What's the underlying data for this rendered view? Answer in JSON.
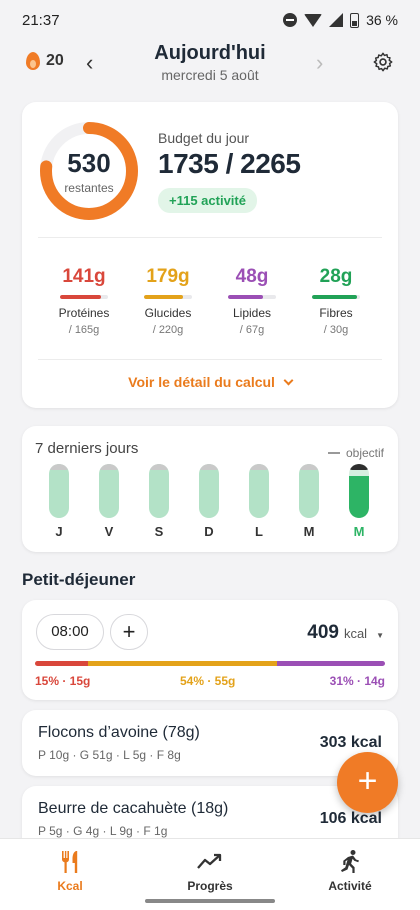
{
  "status_bar": {
    "time": "21:37",
    "battery": "36 %"
  },
  "header": {
    "streak": "20",
    "title": "Aujourd'hui",
    "date": "mercredi 5 août",
    "prev_icon": "chevron-left-icon",
    "next_icon": "chevron-right-icon",
    "settings_icon": "gear-icon"
  },
  "budget": {
    "remaining": "530",
    "remaining_label": "restantes",
    "label": "Budget du jour",
    "value": "1735 / 2265",
    "ring_progress": 0.766,
    "activity": "+115 activité",
    "macros": [
      {
        "value": "141g",
        "name": "Protéines",
        "target": "/ 165g",
        "fill": 0.85,
        "color": "#d9473b"
      },
      {
        "value": "179g",
        "name": "Glucides",
        "target": "/ 220g",
        "fill": 0.81,
        "color": "#e3a21a"
      },
      {
        "value": "48g",
        "name": "Lipides",
        "target": "/ 67g",
        "fill": 0.72,
        "color": "#9b4fb5"
      },
      {
        "value": "28g",
        "name": "Fibres",
        "target": "/ 30g",
        "fill": 0.93,
        "color": "#21a257"
      }
    ],
    "detail_link": "Voir le détail du calcul"
  },
  "week": {
    "title": "7 derniers jours",
    "goal_label": "objectif",
    "days": [
      {
        "day": "J",
        "level": 1.0
      },
      {
        "day": "V",
        "level": 1.0
      },
      {
        "day": "S",
        "level": 1.0
      },
      {
        "day": "D",
        "level": 1.0
      },
      {
        "day": "L",
        "level": 1.0
      },
      {
        "day": "M",
        "level": 1.0
      },
      {
        "day": "M",
        "level": 0.77,
        "active": true
      }
    ]
  },
  "meal": {
    "section_title": "Petit-déjeuner",
    "time": "08:00",
    "add_label": "+",
    "kcal": "409",
    "kcal_unit": "kcal",
    "split": [
      {
        "label": "15% · 15g",
        "share": 0.15,
        "color": "#d9473b"
      },
      {
        "label": "54% · 55g",
        "share": 0.54,
        "color": "#e3a21a"
      },
      {
        "label": "31% · 14g",
        "share": 0.31,
        "color": "#9b4fb5"
      }
    ],
    "foods": [
      {
        "name": "Flocons d’avoine (78g)",
        "macros": "P 10g · G 51g · L 5g · F 8g",
        "kcal": "303 kcal"
      },
      {
        "name": "Beurre de cacahuète (18g)",
        "macros": "P 5g · G 4g · L 9g · F 1g",
        "kcal": "106 kcal"
      }
    ]
  },
  "fab_label": "+",
  "bottom_nav": [
    {
      "label": "Kcal",
      "icon": "fork-knife-icon",
      "active": true
    },
    {
      "label": "Progrès",
      "icon": "trend-up-icon",
      "active": false
    },
    {
      "label": "Activité",
      "icon": "running-person-icon",
      "active": false
    }
  ],
  "colors": {
    "accent": "#f07b26",
    "green": "#2db465",
    "text": "#1f2a37"
  }
}
